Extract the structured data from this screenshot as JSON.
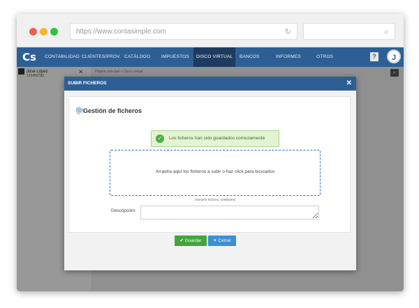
{
  "browser": {
    "url": "https://www.contasimple.com",
    "traffic_lights": [
      "#f45d4f",
      "#f7b52f",
      "#2ec342"
    ]
  },
  "nav": {
    "logo": "Cs",
    "items": [
      "CONTABILIDAD",
      "CLIENTES/PROV.",
      "CATÁLOGO",
      "IMPUESTOS",
      "DISCO VIRTUAL",
      "BANCOS",
      "INFORMES",
      "OTROS"
    ],
    "active": "DISCO VIRTUAL",
    "help": "?",
    "avatar": "J"
  },
  "sidebar": {
    "user_name": "José López",
    "user_id": "123456782"
  },
  "breadcrumb": "Página principal > Disco virtual",
  "modal": {
    "title": "SUBIR FICHEROS",
    "panel_title": "Gestión de ficheros",
    "success_message": "Los ficheros han sido guardados correctamente",
    "dropzone_text": "Arrastra aquí los ficheros a subir o haz click para buscarlos",
    "max_size": "(Tamaño Máximo: 30MBytes)",
    "description_label": "Descripción:",
    "save_label": "Guardar",
    "close_label": "Cerrar"
  },
  "colors": {
    "nav": "#2d5f95",
    "success": "#43a53b",
    "primary": "#3d8fd6"
  }
}
